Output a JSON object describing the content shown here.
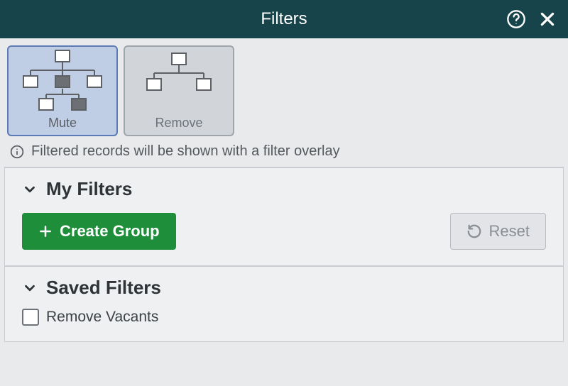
{
  "header": {
    "title": "Filters"
  },
  "modes": {
    "mute": {
      "label": "Mute",
      "selected": true
    },
    "remove": {
      "label": "Remove",
      "selected": false
    }
  },
  "info_text": "Filtered records will be shown with a filter overlay",
  "my_filters": {
    "title": "My Filters",
    "create_group_label": "Create Group",
    "reset_label": "Reset"
  },
  "saved_filters": {
    "title": "Saved Filters",
    "items": [
      {
        "label": "Remove Vacants",
        "checked": false
      }
    ]
  }
}
